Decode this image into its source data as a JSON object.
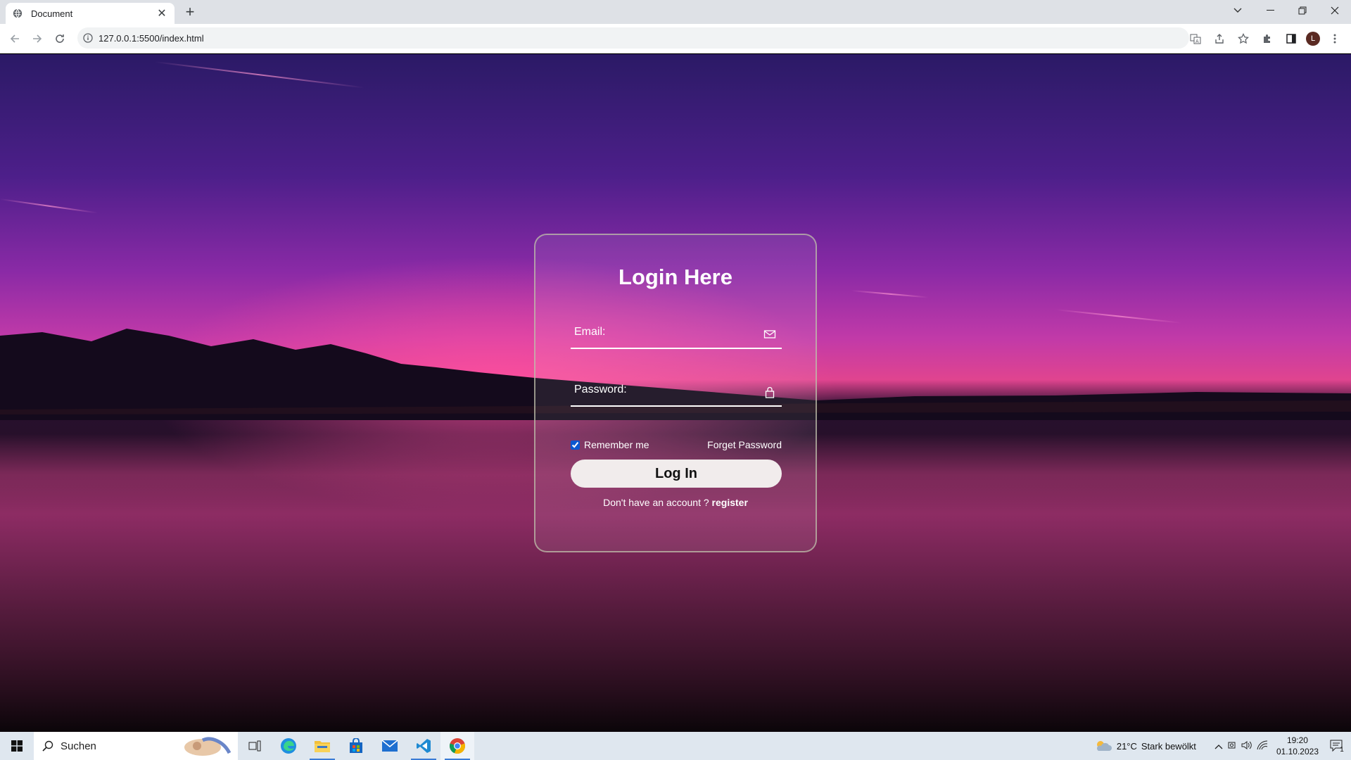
{
  "browser": {
    "tab_title": "Document",
    "url": "127.0.0.1:5500/index.html",
    "profile_initial": "L"
  },
  "login": {
    "heading": "Login Here",
    "email_placeholder": "Email:",
    "password_placeholder": "Password:",
    "remember_label": "Remember me",
    "remember_checked": true,
    "forgot_label": "Forget Password",
    "login_button": "Log In",
    "register_prompt": "Don't have an account ?",
    "register_link": "register"
  },
  "taskbar": {
    "search_label": "Suchen",
    "weather_temp": "21°C",
    "weather_desc": "Stark bewölkt",
    "time": "19:20",
    "date": "01.10.2023",
    "notification_count": "1"
  },
  "colors": {
    "accent_checkbox": "#0b57d0",
    "button_bg": "#f1ecec",
    "card_border": "#bebeaa"
  }
}
